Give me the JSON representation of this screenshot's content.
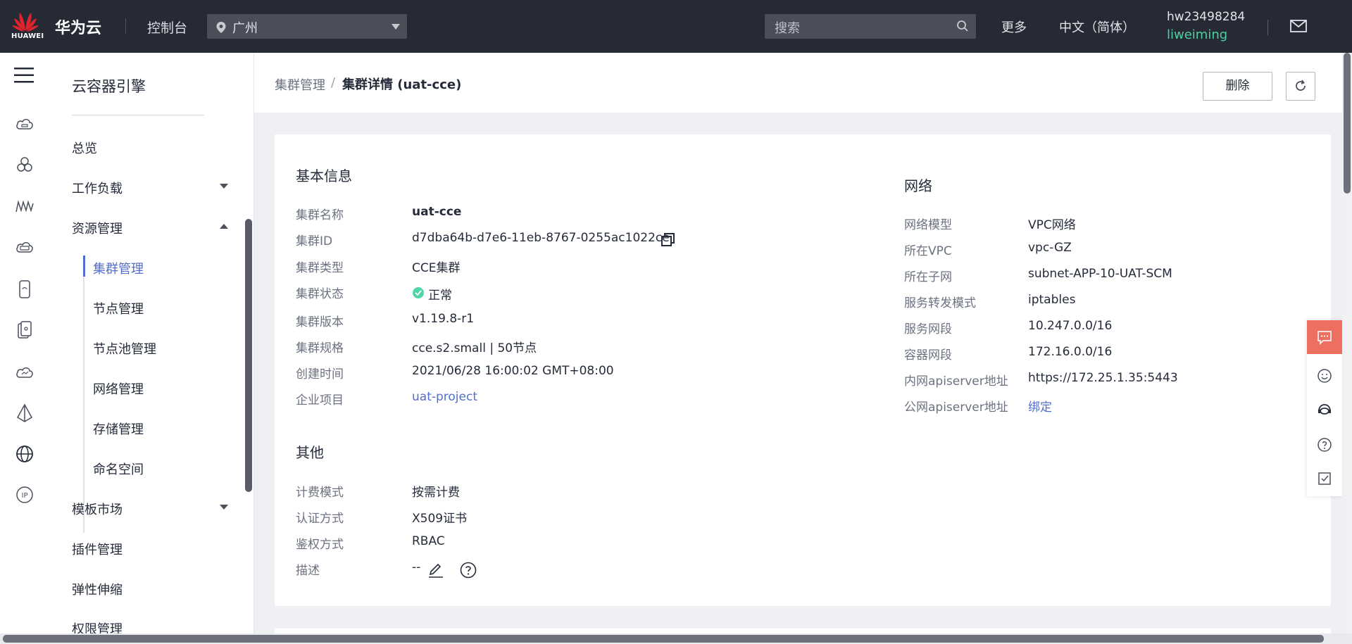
{
  "topbar": {
    "logo_text": "HUAWEI",
    "brand": "华为云",
    "console": "控制台",
    "region": "广州",
    "search_placeholder": "搜索",
    "more": "更多",
    "language": "中文（简体）",
    "username": "hw23498284",
    "subuser": "liweiming"
  },
  "rail": {
    "icons": [
      "cloud-server-icon",
      "cluster-icon",
      "workload-icon",
      "cloud-storage-icon",
      "phone-icon",
      "devices-icon",
      "cloud-icon",
      "vertex-icon",
      "globe-icon",
      "ip-icon"
    ]
  },
  "nav": {
    "title": "云容器引擎",
    "items": {
      "overview": "总览",
      "workload": "工作负载",
      "resource": "资源管理",
      "cluster_mgmt": "集群管理",
      "node_mgmt": "节点管理",
      "nodepool_mgmt": "节点池管理",
      "network_mgmt": "网络管理",
      "storage_mgmt": "存储管理",
      "namespace": "命名空间",
      "template_market": "模板市场",
      "addon_mgmt": "插件管理",
      "autoscaling": "弹性伸缩",
      "permission_mgmt": "权限管理"
    }
  },
  "header": {
    "breadcrumb_parent": "集群管理",
    "breadcrumb_sep": "/",
    "breadcrumb_current": "集群详情 (uat-cce)",
    "delete_label": "删除"
  },
  "basic": {
    "title": "基本信息",
    "name_label": "集群名称",
    "name": "uat-cce",
    "id_label": "集群ID",
    "id": "d7dba64b-d7e6-11eb-8767-0255ac1022ce",
    "type_label": "集群类型",
    "type": "CCE集群",
    "status_label": "集群状态",
    "status": "正常",
    "version_label": "集群版本",
    "version": "v1.19.8-r1",
    "spec_label": "集群规格",
    "spec": "cce.s2.small | 50节点",
    "created_label": "创建时间",
    "created": "2021/06/28 16:00:02 GMT+08:00",
    "project_label": "企业项目",
    "project": "uat-project"
  },
  "network": {
    "title": "网络",
    "model_label": "网络模型",
    "model": "VPC网络",
    "vpc_label": "所在VPC",
    "vpc": "vpc-GZ",
    "subnet_label": "所在子网",
    "subnet": "subnet-APP-10-UAT-SCM",
    "forward_label": "服务转发模式",
    "forward": "iptables",
    "svc_cidr_label": "服务网段",
    "svc_cidr": "10.247.0.0/16",
    "container_cidr_label": "容器网段",
    "container_cidr": "172.16.0.0/16",
    "internal_api_label": "内网apiserver地址",
    "internal_api": "https://172.25.1.35:5443",
    "public_api_label": "公网apiserver地址",
    "public_api": "绑定"
  },
  "other": {
    "title": "其他",
    "billing_label": "计费模式",
    "billing": "按需计费",
    "auth_label": "认证方式",
    "auth": "X509证书",
    "authz_label": "鉴权方式",
    "authz": "RBAC",
    "desc_label": "描述",
    "desc": "--"
  },
  "colors": {
    "topbar_bg": "#262a35",
    "link": "#526ecc",
    "status_ok": "#50d4ab",
    "float_active": "#ec6f61",
    "subuser": "#4fd0a0"
  }
}
